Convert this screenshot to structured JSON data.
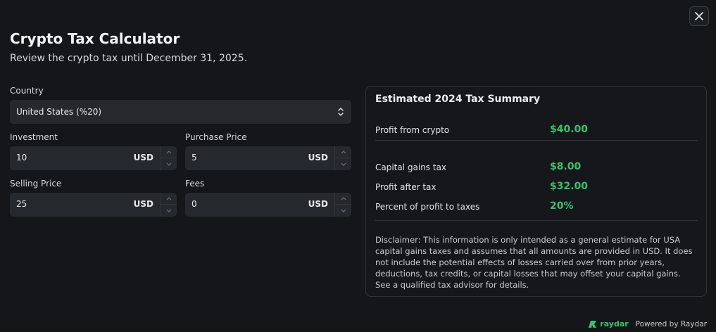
{
  "header": {
    "title": "Crypto Tax Calculator",
    "subtitle": "Review the crypto tax until December 31, 2025."
  },
  "form": {
    "country": {
      "label": "Country",
      "value": "United States (%20)"
    },
    "investment": {
      "label": "Investment",
      "value": "10",
      "unit": "USD"
    },
    "purchase_price": {
      "label": "Purchase Price",
      "value": "5",
      "unit": "USD"
    },
    "selling_price": {
      "label": "Selling Price",
      "value": "25",
      "unit": "USD"
    },
    "fees": {
      "label": "Fees",
      "value": "0",
      "unit": "USD"
    }
  },
  "summary": {
    "title": "Estimated 2024 Tax Summary",
    "rows": [
      {
        "label": "Profit from crypto",
        "value": "$40.00"
      },
      {
        "label": "Capital gains tax",
        "value": "$8.00"
      },
      {
        "label": "Profit after tax",
        "value": "$32.00"
      },
      {
        "label": "Percent of profit to taxes",
        "value": "20%"
      }
    ],
    "disclaimer": "Disclaimer: This information is only intended as a general estimate for USA capital gains taxes and assumes that all amounts are provided in USD. It does not include the potential effects of losses carried over from prior years, deductions, tax credits, or capital losses that may offset your capital gains. See a qualified tax advisor for details."
  },
  "footer": {
    "brand": "raydar",
    "powered_by": "Powered by Raydar"
  },
  "icons": {
    "close": "close-icon",
    "select_chevron": "chevron-up-down-icon",
    "stepper_up": "chevron-up-icon",
    "stepper_down": "chevron-down-icon",
    "logo": "raydar-logo-icon"
  },
  "colors": {
    "background": "#141619",
    "field": "#25282d",
    "accent_green": "#35c36e"
  }
}
